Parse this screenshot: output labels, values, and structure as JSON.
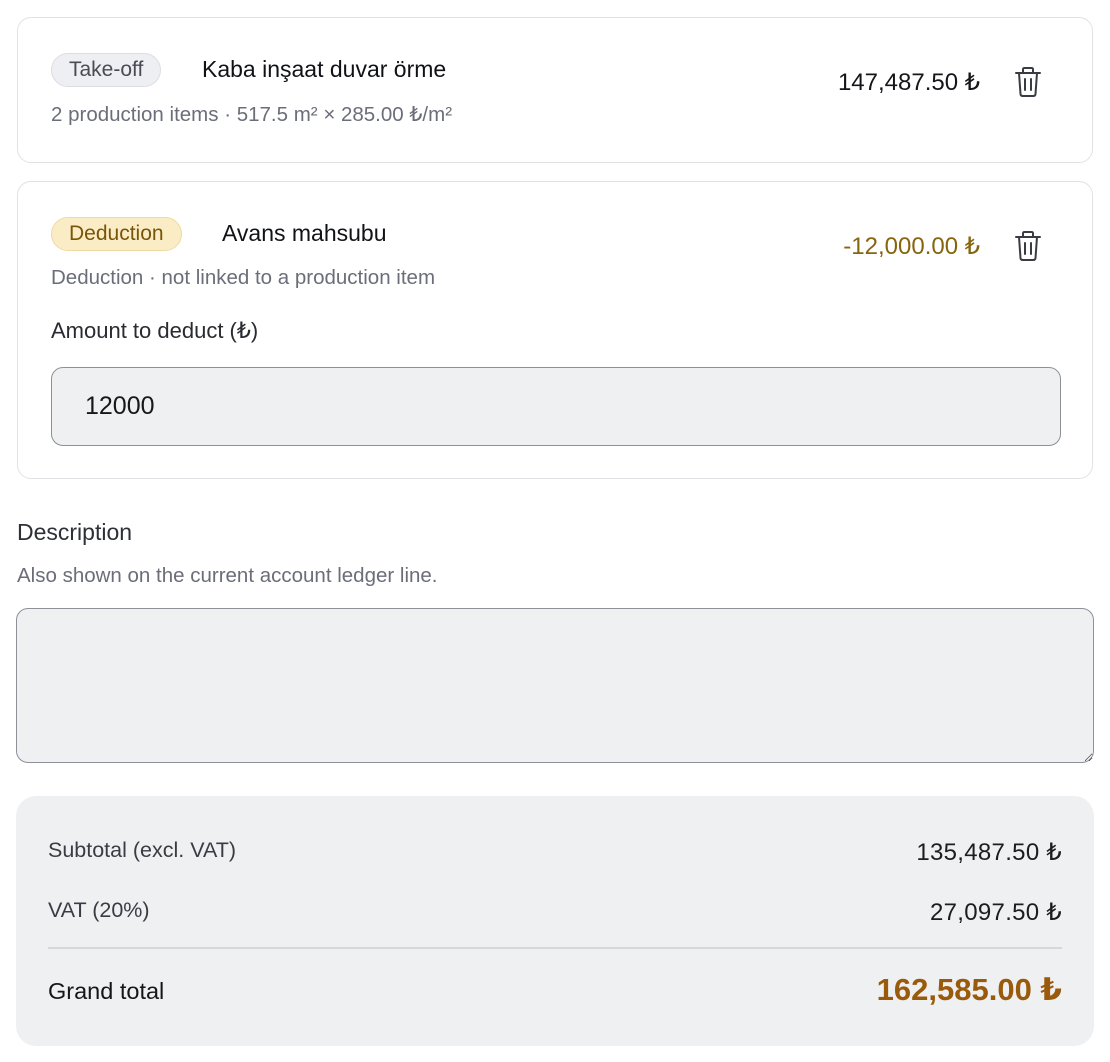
{
  "items": [
    {
      "badge": "Take-off",
      "title": "Kaba inşaat duvar örme",
      "subtitle": "2 production items · 517.5 m² × 285.00 ₺/m²",
      "amount": "147,487.50 ₺",
      "delete_icon": "trash-icon"
    },
    {
      "badge": "Deduction",
      "title": "Avans mahsubu",
      "subtitle": "Deduction · not linked to a production item",
      "amount": "-12,000.00 ₺",
      "delete_icon": "trash-icon",
      "field_label": "Amount to deduct (₺)",
      "field_value": "12000"
    }
  ],
  "description": {
    "label": "Description",
    "help": "Also shown on the current account ledger line.",
    "value": ""
  },
  "totals": {
    "subtotal_label": "Subtotal (excl. VAT)",
    "subtotal_value": "135,487.50 ₺",
    "vat_label": "VAT (20%)",
    "vat_value": "27,097.50 ₺",
    "grand_label": "Grand total",
    "grand_value": "162,585.00 ₺"
  },
  "colors": {
    "deduction_amount": "#86650f",
    "grand_total": "#9a5a0c",
    "deduction_badge_bg": "#faedc6"
  }
}
